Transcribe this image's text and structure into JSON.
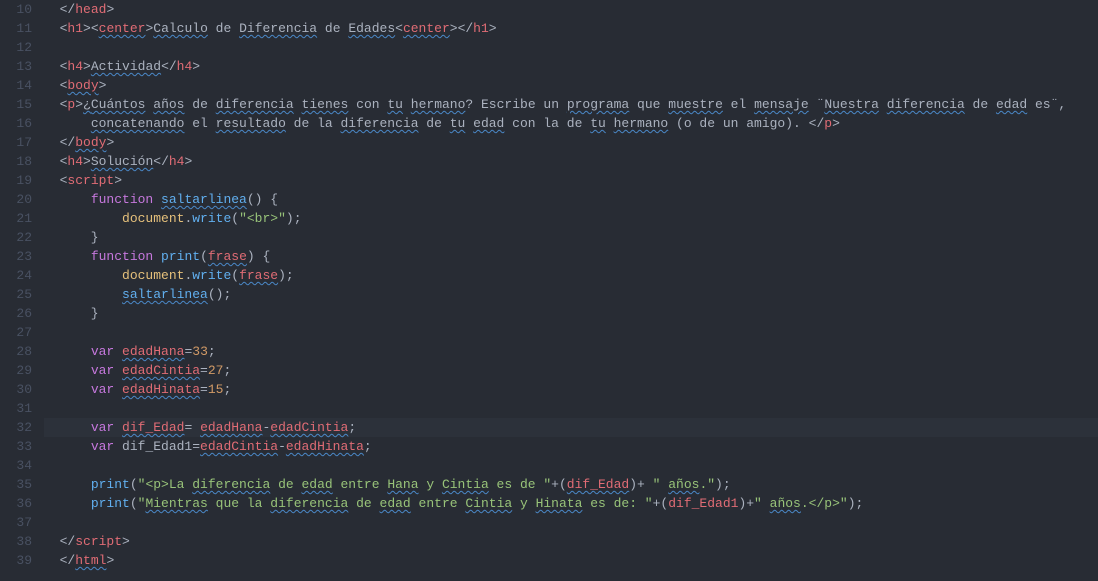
{
  "lineStart": 10,
  "lineEnd": 39,
  "highlightLine": 32,
  "lines": [
    {
      "n": 10,
      "indent": 1,
      "segs": [
        {
          "t": "  ",
          "c": "plain"
        },
        {
          "t": "</",
          "c": "punc"
        },
        {
          "t": "head",
          "c": "tag"
        },
        {
          "t": ">",
          "c": "punc"
        }
      ]
    },
    {
      "n": 11,
      "indent": 1,
      "segs": [
        {
          "t": "  ",
          "c": "plain"
        },
        {
          "t": "<",
          "c": "punc"
        },
        {
          "t": "h1",
          "c": "tag"
        },
        {
          "t": "><",
          "c": "punc"
        },
        {
          "t": "center",
          "c": "tag warn"
        },
        {
          "t": ">",
          "c": "punc"
        },
        {
          "t": "Calculo",
          "c": "plain warn"
        },
        {
          "t": " de ",
          "c": "plain"
        },
        {
          "t": "Diferencia",
          "c": "plain warn"
        },
        {
          "t": " de ",
          "c": "plain"
        },
        {
          "t": "Edades",
          "c": "plain warn"
        },
        {
          "t": "<",
          "c": "punc"
        },
        {
          "t": "center",
          "c": "tag warn"
        },
        {
          "t": "></",
          "c": "punc"
        },
        {
          "t": "h1",
          "c": "tag"
        },
        {
          "t": ">",
          "c": "punc"
        }
      ]
    },
    {
      "n": 12,
      "indent": 0,
      "segs": []
    },
    {
      "n": 13,
      "indent": 1,
      "segs": [
        {
          "t": "  ",
          "c": "plain"
        },
        {
          "t": "<",
          "c": "punc"
        },
        {
          "t": "h4",
          "c": "tag"
        },
        {
          "t": ">",
          "c": "punc"
        },
        {
          "t": "Actividad",
          "c": "plain warn"
        },
        {
          "t": "</",
          "c": "punc"
        },
        {
          "t": "h4",
          "c": "tag"
        },
        {
          "t": ">",
          "c": "punc"
        }
      ]
    },
    {
      "n": 14,
      "indent": 1,
      "segs": [
        {
          "t": "  ",
          "c": "plain"
        },
        {
          "t": "<",
          "c": "punc"
        },
        {
          "t": "body",
          "c": "tag warn"
        },
        {
          "t": ">",
          "c": "punc"
        }
      ]
    },
    {
      "n": 15,
      "indent": 1,
      "segs": [
        {
          "t": "  ",
          "c": "plain"
        },
        {
          "t": "<",
          "c": "punc"
        },
        {
          "t": "p",
          "c": "tag"
        },
        {
          "t": ">",
          "c": "punc"
        },
        {
          "t": "¿",
          "c": "plain warn"
        },
        {
          "t": "Cuántos",
          "c": "plain warn"
        },
        {
          "t": " ",
          "c": "plain"
        },
        {
          "t": "años",
          "c": "plain warn"
        },
        {
          "t": " de ",
          "c": "plain"
        },
        {
          "t": "diferencia",
          "c": "plain warn"
        },
        {
          "t": " ",
          "c": "plain"
        },
        {
          "t": "tienes",
          "c": "plain warn"
        },
        {
          "t": " con ",
          "c": "plain"
        },
        {
          "t": "tu",
          "c": "plain warn"
        },
        {
          "t": " ",
          "c": "plain"
        },
        {
          "t": "hermano",
          "c": "plain warn"
        },
        {
          "t": "? Escribe un ",
          "c": "plain"
        },
        {
          "t": "programa",
          "c": "plain warn"
        },
        {
          "t": " que ",
          "c": "plain"
        },
        {
          "t": "muestre",
          "c": "plain warn"
        },
        {
          "t": " el ",
          "c": "plain"
        },
        {
          "t": "mensaje",
          "c": "plain warn"
        },
        {
          "t": " ¨",
          "c": "plain"
        },
        {
          "t": "Nuestra",
          "c": "plain warn"
        },
        {
          "t": " ",
          "c": "plain"
        },
        {
          "t": "diferencia",
          "c": "plain warn"
        },
        {
          "t": " de ",
          "c": "plain"
        },
        {
          "t": "edad",
          "c": "plain warn"
        },
        {
          "t": " es¨, ",
          "c": "plain"
        }
      ]
    },
    {
      "n": 16,
      "indent": 2,
      "segs": [
        {
          "t": "      ",
          "c": "plain"
        },
        {
          "t": "concatenando",
          "c": "plain warn"
        },
        {
          "t": " el ",
          "c": "plain"
        },
        {
          "t": "resultado",
          "c": "plain warn"
        },
        {
          "t": " de la ",
          "c": "plain"
        },
        {
          "t": "diferencia",
          "c": "plain warn"
        },
        {
          "t": " de ",
          "c": "plain"
        },
        {
          "t": "tu",
          "c": "plain warn"
        },
        {
          "t": " ",
          "c": "plain"
        },
        {
          "t": "edad",
          "c": "plain warn"
        },
        {
          "t": " con la de ",
          "c": "plain"
        },
        {
          "t": "tu",
          "c": "plain warn"
        },
        {
          "t": " ",
          "c": "plain"
        },
        {
          "t": "hermano",
          "c": "plain warn"
        },
        {
          "t": " (o de un amigo). ",
          "c": "plain"
        },
        {
          "t": "</",
          "c": "punc"
        },
        {
          "t": "p",
          "c": "tag"
        },
        {
          "t": ">",
          "c": "punc"
        }
      ]
    },
    {
      "n": 17,
      "indent": 1,
      "segs": [
        {
          "t": "  ",
          "c": "plain"
        },
        {
          "t": "</",
          "c": "punc"
        },
        {
          "t": "body",
          "c": "tag warn"
        },
        {
          "t": ">",
          "c": "punc"
        }
      ]
    },
    {
      "n": 18,
      "indent": 1,
      "segs": [
        {
          "t": "  ",
          "c": "plain"
        },
        {
          "t": "<",
          "c": "punc"
        },
        {
          "t": "h4",
          "c": "tag"
        },
        {
          "t": ">",
          "c": "punc"
        },
        {
          "t": "Solución",
          "c": "plain warn"
        },
        {
          "t": "</",
          "c": "punc"
        },
        {
          "t": "h4",
          "c": "tag"
        },
        {
          "t": ">",
          "c": "punc"
        }
      ]
    },
    {
      "n": 19,
      "indent": 1,
      "segs": [
        {
          "t": "  ",
          "c": "plain"
        },
        {
          "t": "<",
          "c": "punc"
        },
        {
          "t": "script",
          "c": "tag"
        },
        {
          "t": ">",
          "c": "punc"
        }
      ]
    },
    {
      "n": 20,
      "indent": 2,
      "segs": [
        {
          "t": "      ",
          "c": "plain"
        },
        {
          "t": "function",
          "c": "kw"
        },
        {
          "t": " ",
          "c": "plain"
        },
        {
          "t": "saltarlinea",
          "c": "fn warn"
        },
        {
          "t": "() {",
          "c": "punc"
        }
      ]
    },
    {
      "n": 21,
      "indent": 3,
      "segs": [
        {
          "t": "          ",
          "c": "plain"
        },
        {
          "t": "document",
          "c": "obj"
        },
        {
          "t": ".",
          "c": "punc"
        },
        {
          "t": "write",
          "c": "fn"
        },
        {
          "t": "(",
          "c": "punc"
        },
        {
          "t": "\"<br>\"",
          "c": "str"
        },
        {
          "t": ");",
          "c": "punc"
        }
      ]
    },
    {
      "n": 22,
      "indent": 2,
      "segs": [
        {
          "t": "      }",
          "c": "punc"
        }
      ]
    },
    {
      "n": 23,
      "indent": 2,
      "segs": [
        {
          "t": "      ",
          "c": "plain"
        },
        {
          "t": "function",
          "c": "kw"
        },
        {
          "t": " ",
          "c": "plain"
        },
        {
          "t": "print",
          "c": "fn"
        },
        {
          "t": "(",
          "c": "punc"
        },
        {
          "t": "frase",
          "c": "var warn"
        },
        {
          "t": ") {",
          "c": "punc"
        }
      ]
    },
    {
      "n": 24,
      "indent": 3,
      "segs": [
        {
          "t": "          ",
          "c": "plain"
        },
        {
          "t": "document",
          "c": "obj"
        },
        {
          "t": ".",
          "c": "punc"
        },
        {
          "t": "write",
          "c": "fn"
        },
        {
          "t": "(",
          "c": "punc"
        },
        {
          "t": "frase",
          "c": "var warn"
        },
        {
          "t": ");",
          "c": "punc"
        }
      ]
    },
    {
      "n": 25,
      "indent": 3,
      "segs": [
        {
          "t": "          ",
          "c": "plain"
        },
        {
          "t": "saltarlinea",
          "c": "fn warn"
        },
        {
          "t": "();",
          "c": "punc"
        }
      ]
    },
    {
      "n": 26,
      "indent": 2,
      "segs": [
        {
          "t": "      }",
          "c": "punc"
        }
      ]
    },
    {
      "n": 27,
      "indent": 0,
      "segs": []
    },
    {
      "n": 28,
      "indent": 2,
      "segs": [
        {
          "t": "      ",
          "c": "plain"
        },
        {
          "t": "var",
          "c": "kw"
        },
        {
          "t": " ",
          "c": "plain"
        },
        {
          "t": "edadHana",
          "c": "var warn"
        },
        {
          "t": "=",
          "c": "punc"
        },
        {
          "t": "33",
          "c": "num"
        },
        {
          "t": ";",
          "c": "punc"
        }
      ]
    },
    {
      "n": 29,
      "indent": 2,
      "segs": [
        {
          "t": "      ",
          "c": "plain"
        },
        {
          "t": "var",
          "c": "kw"
        },
        {
          "t": " ",
          "c": "plain"
        },
        {
          "t": "edadCintia",
          "c": "var warn"
        },
        {
          "t": "=",
          "c": "punc"
        },
        {
          "t": "27",
          "c": "num"
        },
        {
          "t": ";",
          "c": "punc"
        }
      ]
    },
    {
      "n": 30,
      "indent": 2,
      "segs": [
        {
          "t": "      ",
          "c": "plain"
        },
        {
          "t": "var",
          "c": "kw"
        },
        {
          "t": " ",
          "c": "plain"
        },
        {
          "t": "edadHinata",
          "c": "var warn"
        },
        {
          "t": "=",
          "c": "punc"
        },
        {
          "t": "15",
          "c": "num"
        },
        {
          "t": ";",
          "c": "punc"
        }
      ]
    },
    {
      "n": 31,
      "indent": 0,
      "segs": []
    },
    {
      "n": 32,
      "indent": 2,
      "hl": true,
      "segs": [
        {
          "t": "      ",
          "c": "plain"
        },
        {
          "t": "var",
          "c": "kw"
        },
        {
          "t": " ",
          "c": "plain"
        },
        {
          "t": "dif_Edad",
          "c": "var warn"
        },
        {
          "t": "= ",
          "c": "punc"
        },
        {
          "t": "edadHana",
          "c": "var warn"
        },
        {
          "t": "-",
          "c": "punc"
        },
        {
          "t": "edadCintia",
          "c": "var warn"
        },
        {
          "t": ";",
          "c": "punc"
        }
      ]
    },
    {
      "n": 33,
      "indent": 2,
      "segs": [
        {
          "t": "      ",
          "c": "plain"
        },
        {
          "t": "var",
          "c": "kw"
        },
        {
          "t": " dif_Edad1=",
          "c": "plain"
        },
        {
          "t": "edadCintia",
          "c": "var warn"
        },
        {
          "t": "-",
          "c": "punc"
        },
        {
          "t": "edadHinata",
          "c": "var warn"
        },
        {
          "t": ";",
          "c": "punc"
        }
      ]
    },
    {
      "n": 34,
      "indent": 0,
      "segs": []
    },
    {
      "n": 35,
      "indent": 2,
      "segs": [
        {
          "t": "      ",
          "c": "plain"
        },
        {
          "t": "print",
          "c": "fn"
        },
        {
          "t": "(",
          "c": "punc"
        },
        {
          "t": "\"<p>La ",
          "c": "str"
        },
        {
          "t": "diferencia",
          "c": "str warn"
        },
        {
          "t": " de ",
          "c": "str"
        },
        {
          "t": "edad",
          "c": "str warn"
        },
        {
          "t": " entre ",
          "c": "str"
        },
        {
          "t": "Hana",
          "c": "str warn"
        },
        {
          "t": " y ",
          "c": "str"
        },
        {
          "t": "Cintia",
          "c": "str warn"
        },
        {
          "t": " es de \"",
          "c": "str"
        },
        {
          "t": "+(",
          "c": "punc"
        },
        {
          "t": "dif_Edad",
          "c": "var warn"
        },
        {
          "t": ")+ ",
          "c": "punc"
        },
        {
          "t": "\" ",
          "c": "str"
        },
        {
          "t": "años",
          "c": "str warn"
        },
        {
          "t": ".\"",
          "c": "str"
        },
        {
          "t": ");",
          "c": "punc"
        }
      ]
    },
    {
      "n": 36,
      "indent": 2,
      "segs": [
        {
          "t": "      ",
          "c": "plain"
        },
        {
          "t": "print",
          "c": "fn"
        },
        {
          "t": "(",
          "c": "punc"
        },
        {
          "t": "\"",
          "c": "str"
        },
        {
          "t": "Mientras",
          "c": "str warn"
        },
        {
          "t": " que la ",
          "c": "str"
        },
        {
          "t": "diferencia",
          "c": "str warn"
        },
        {
          "t": " de ",
          "c": "str"
        },
        {
          "t": "edad",
          "c": "str warn"
        },
        {
          "t": " entre ",
          "c": "str"
        },
        {
          "t": "Cintia",
          "c": "str warn"
        },
        {
          "t": " y ",
          "c": "str"
        },
        {
          "t": "Hinata",
          "c": "str warn"
        },
        {
          "t": " es de: \"",
          "c": "str"
        },
        {
          "t": "+(",
          "c": "punc"
        },
        {
          "t": "dif_Edad1",
          "c": "var"
        },
        {
          "t": ")+",
          "c": "punc"
        },
        {
          "t": "\" ",
          "c": "str"
        },
        {
          "t": "años",
          "c": "str warn"
        },
        {
          "t": ".</p>\"",
          "c": "str"
        },
        {
          "t": ");",
          "c": "punc"
        }
      ]
    },
    {
      "n": 37,
      "indent": 0,
      "segs": []
    },
    {
      "n": 38,
      "indent": 1,
      "segs": [
        {
          "t": "  ",
          "c": "plain"
        },
        {
          "t": "</",
          "c": "punc"
        },
        {
          "t": "script",
          "c": "tag"
        },
        {
          "t": ">",
          "c": "punc"
        }
      ]
    },
    {
      "n": 39,
      "indent": 1,
      "segs": [
        {
          "t": "  ",
          "c": "plain"
        },
        {
          "t": "</",
          "c": "punc"
        },
        {
          "t": "html",
          "c": "tag warn"
        },
        {
          "t": ">",
          "c": "punc"
        }
      ]
    }
  ]
}
